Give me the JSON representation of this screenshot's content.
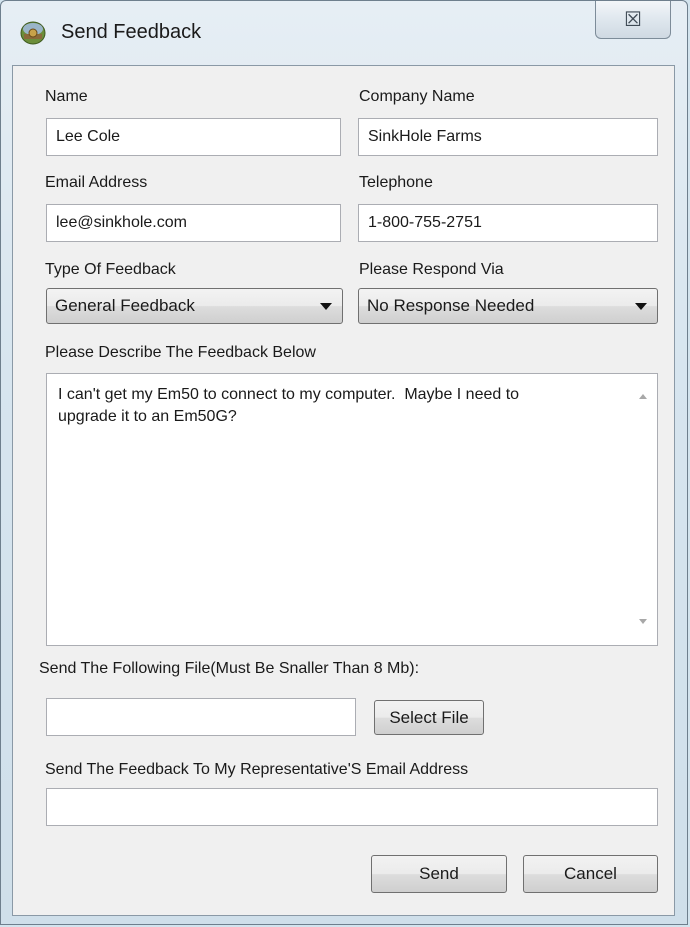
{
  "window": {
    "title": "Send Feedback",
    "close_glyph": "☒"
  },
  "form": {
    "name_label": "Name",
    "name_value": "Lee Cole",
    "company_label": "Company Name",
    "company_value": "SinkHole Farms",
    "email_label": "Email Address",
    "email_value": "lee@sinkhole.com",
    "telephone_label": "Telephone",
    "telephone_value": "1-800-755-2751",
    "feedback_type_label": "Type Of Feedback",
    "feedback_type_value": "General Feedback",
    "respond_via_label": "Please Respond Via",
    "respond_via_value": "No Response Needed",
    "description_label": "Please Describe The Feedback Below",
    "description_value": "I can't get my Em50 to connect to my computer.  Maybe I need to upgrade it to an Em50G?",
    "file_label": "Send The Following File(Must Be Snaller Than 8 Mb):",
    "file_value": "",
    "select_file_label": "Select File",
    "rep_email_label": "Send The Feedback To My Representative'S Email Address",
    "rep_email_value": ""
  },
  "actions": {
    "send_label": "Send",
    "cancel_label": "Cancel"
  },
  "icons": {
    "app_icon": "feedback-app-icon",
    "close_icon": "close-icon",
    "dropdown_icon": "chevron-down-icon"
  }
}
